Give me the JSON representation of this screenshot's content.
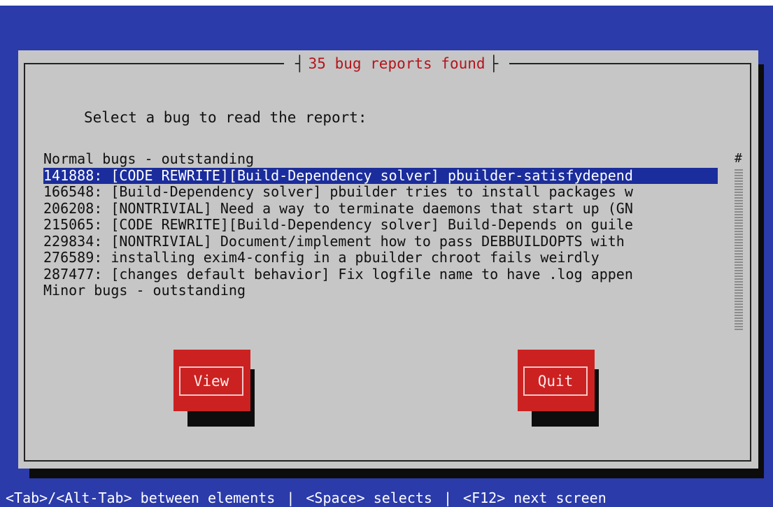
{
  "dialog": {
    "title": "35 bug reports found",
    "prompt": "Select a bug to read the report:",
    "list": {
      "rows": [
        "Normal bugs - outstanding",
        "141888: [CODE REWRITE][Build-Dependency solver] pbuilder-satisfydepend",
        "166548: [Build-Dependency solver] pbuilder tries to install packages w",
        "206208: [NONTRIVIAL] Need a way to terminate daemons that start up (GN",
        "215065: [CODE REWRITE][Build-Dependency solver] Build-Depends on guile",
        "229834: [NONTRIVIAL] Document/implement how to pass DEBBUILDOPTS with",
        "276589: installing exim4-config in a pbuilder chroot fails weirdly",
        "287477: [changes default behavior] Fix logfile name to have .log appen",
        "Minor bugs - outstanding"
      ],
      "selected_index": 1,
      "scroll_mark": "#"
    },
    "buttons": {
      "view": "View",
      "quit": "Quit"
    }
  },
  "help_bar": {
    "item1": "<Tab>/<Alt-Tab> between elements",
    "separator": "|",
    "item2": "<Space> selects",
    "item3": "<F12> next screen"
  },
  "colors": {
    "background": "#2b3ba9",
    "dialog": "#c6c6c6",
    "title": "#b4141b",
    "selection": "#1b2d9c",
    "button": "#cc2121"
  }
}
